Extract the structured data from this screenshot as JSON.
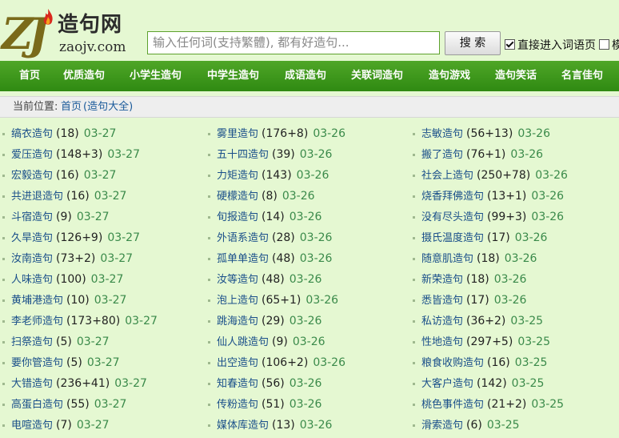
{
  "logo": {
    "mark": "ZJ",
    "name": "造句网",
    "domain": "zaojv.com"
  },
  "search": {
    "placeholder": "输入任何词(支持繁體), 都有好造句...",
    "button": "搜 索"
  },
  "options": [
    {
      "label": "直接进入词语页",
      "checked": true
    },
    {
      "label": "模",
      "checked": false
    }
  ],
  "nav": [
    "首页",
    "优质造句",
    "小学生造句",
    "中学生造句",
    "成语造句",
    "关联词造句",
    "造句游戏",
    "造句笑话",
    "名言佳句"
  ],
  "breadcrumb": {
    "label": "当前位置:",
    "home": "首页",
    "current": "(造句大全)"
  },
  "columns": [
    [
      {
        "word": "缟衣造句",
        "count": "(18)",
        "date": "03-27"
      },
      {
        "word": "爱压造句",
        "count": "(148+3)",
        "date": "03-27"
      },
      {
        "word": "宏毅造句",
        "count": "(16)",
        "date": "03-27"
      },
      {
        "word": "共进退造句",
        "count": "(16)",
        "date": "03-27"
      },
      {
        "word": "斗宿造句",
        "count": "(9)",
        "date": "03-27"
      },
      {
        "word": "久旱造句",
        "count": "(126+9)",
        "date": "03-27"
      },
      {
        "word": "汝南造句",
        "count": "(73+2)",
        "date": "03-27"
      },
      {
        "word": "人味造句",
        "count": "(100)",
        "date": "03-27"
      },
      {
        "word": "黄埔港造句",
        "count": "(10)",
        "date": "03-27"
      },
      {
        "word": "李老师造句",
        "count": "(173+80)",
        "date": "03-27"
      },
      {
        "word": "扫祭造句",
        "count": "(5)",
        "date": "03-27"
      },
      {
        "word": "要你管造句",
        "count": "(5)",
        "date": "03-27"
      },
      {
        "word": "大错造句",
        "count": "(236+41)",
        "date": "03-27"
      },
      {
        "word": "高蛋白造句",
        "count": "(55)",
        "date": "03-27"
      },
      {
        "word": "电喧造句",
        "count": "(7)",
        "date": "03-27"
      }
    ],
    [
      {
        "word": "雾里造句",
        "count": "(176+8)",
        "date": "03-26"
      },
      {
        "word": "五十四造句",
        "count": "(39)",
        "date": "03-26"
      },
      {
        "word": "力矩造句",
        "count": "(143)",
        "date": "03-26"
      },
      {
        "word": "硬檬造句",
        "count": "(8)",
        "date": "03-26"
      },
      {
        "word": "旬报造句",
        "count": "(14)",
        "date": "03-26"
      },
      {
        "word": "外语系造句",
        "count": "(28)",
        "date": "03-26"
      },
      {
        "word": "孤单单造句",
        "count": "(48)",
        "date": "03-26"
      },
      {
        "word": "汝等造句",
        "count": "(48)",
        "date": "03-26"
      },
      {
        "word": "泡上造句",
        "count": "(65+1)",
        "date": "03-26"
      },
      {
        "word": "跳海造句",
        "count": "(29)",
        "date": "03-26"
      },
      {
        "word": "仙人跳造句",
        "count": "(9)",
        "date": "03-26"
      },
      {
        "word": "出空造句",
        "count": "(106+2)",
        "date": "03-26"
      },
      {
        "word": "知春造句",
        "count": "(56)",
        "date": "03-26"
      },
      {
        "word": "传粉造句",
        "count": "(51)",
        "date": "03-26"
      },
      {
        "word": "媒体库造句",
        "count": "(13)",
        "date": "03-26"
      }
    ],
    [
      {
        "word": "志敏造句",
        "count": "(56+13)",
        "date": "03-26"
      },
      {
        "word": "搬了造句",
        "count": "(76+1)",
        "date": "03-26"
      },
      {
        "word": "社会上造句",
        "count": "(250+78)",
        "date": "03-26"
      },
      {
        "word": "烧香拜佛造句",
        "count": "(13+1)",
        "date": "03-26"
      },
      {
        "word": "没有尽头造句",
        "count": "(99+3)",
        "date": "03-26"
      },
      {
        "word": "摄氏温度造句",
        "count": "(17)",
        "date": "03-26"
      },
      {
        "word": "随意肌造句",
        "count": "(18)",
        "date": "03-26"
      },
      {
        "word": "新荣造句",
        "count": "(18)",
        "date": "03-26"
      },
      {
        "word": "悉皆造句",
        "count": "(17)",
        "date": "03-26"
      },
      {
        "word": "私访造句",
        "count": "(36+2)",
        "date": "03-25"
      },
      {
        "word": "性地造句",
        "count": "(297+5)",
        "date": "03-25"
      },
      {
        "word": "粮食收购造句",
        "count": "(16)",
        "date": "03-25"
      },
      {
        "word": "大客户造句",
        "count": "(142)",
        "date": "03-25"
      },
      {
        "word": "桃色事件造句",
        "count": "(21+2)",
        "date": "03-25"
      },
      {
        "word": "滑索造句",
        "count": "(6)",
        "date": "03-25"
      }
    ]
  ]
}
